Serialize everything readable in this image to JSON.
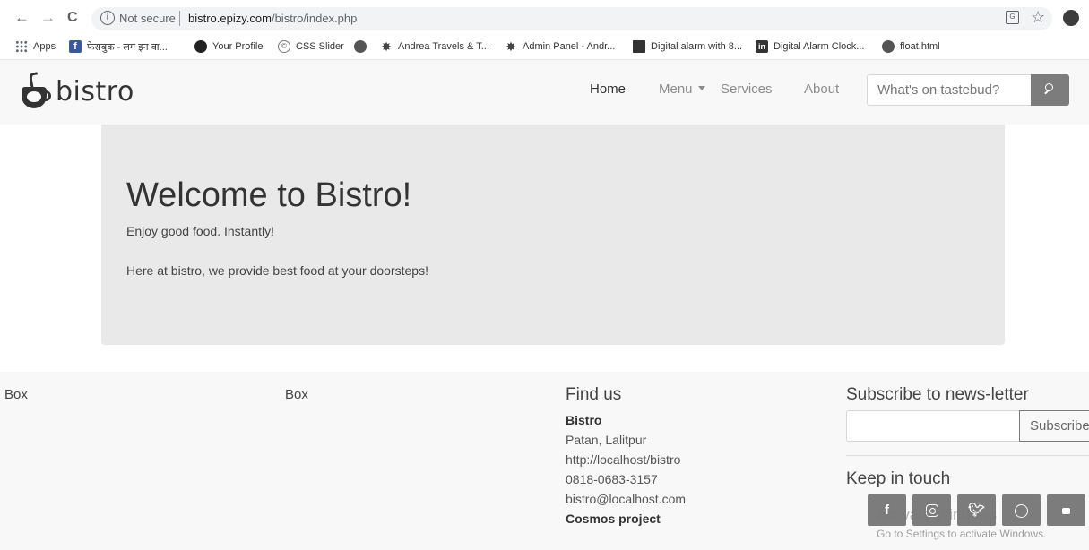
{
  "browser": {
    "back": "←",
    "forward": "→",
    "reload": "C",
    "security_label": "Not secure",
    "url_host": "bistro.epizy.com",
    "url_path": "/bistro/index.php",
    "star": "☆"
  },
  "bookmarks": [
    {
      "label": "Apps",
      "icon": "apps-icon"
    },
    {
      "label": "फेसबुक - लग इन वा...",
      "icon": "facebook-icon"
    },
    {
      "label": "Your Profile",
      "icon": "github-icon"
    },
    {
      "label": "CSS Slider",
      "icon": "css-slider-icon"
    },
    {
      "label": "",
      "icon": "globe-icon"
    },
    {
      "label": "Andrea Travels & T...",
      "icon": "star-logo-icon"
    },
    {
      "label": "Admin Panel - Andr...",
      "icon": "star-logo-icon"
    },
    {
      "label": "Digital alarm with 8...",
      "icon": "document-icon"
    },
    {
      "label": "Digital Alarm Clock...",
      "icon": "linkedin-icon"
    },
    {
      "label": "float.html",
      "icon": "globe-icon"
    }
  ],
  "site": {
    "brand": "bistro",
    "nav": {
      "home": "Home",
      "menu": "Menu",
      "services": "Services",
      "about": "About"
    },
    "search": {
      "placeholder": "What's on tastebud?"
    },
    "hero": {
      "title": "Welcome to Bistro!",
      "lead": "Enjoy good food. Instantly!",
      "text": "Here at bistro, we provide best food at your doorsteps!"
    },
    "footer": {
      "box1": "Box",
      "box2": "Box",
      "find_us": {
        "heading": "Find us",
        "name": "Bistro",
        "address": "Patan, Lalitpur",
        "website": "http://localhost/bistro",
        "phone": "0818-0683-3157",
        "email": "bistro@localhost.com",
        "project": "Cosmos project"
      },
      "subscribe": {
        "heading": "Subscribe to news-letter",
        "button": "Subscribe"
      },
      "keep_in_touch": {
        "heading": "Keep in touch",
        "facebook": "f"
      }
    }
  },
  "os_watermark": {
    "line1": "Activate Windows",
    "line2": "Go to Settings to activate Windows."
  },
  "colors": {
    "accent_button": "#7c7c7c",
    "jumbotron_bg": "#e9e9e9",
    "navbar_bg": "#f8f8f8"
  }
}
